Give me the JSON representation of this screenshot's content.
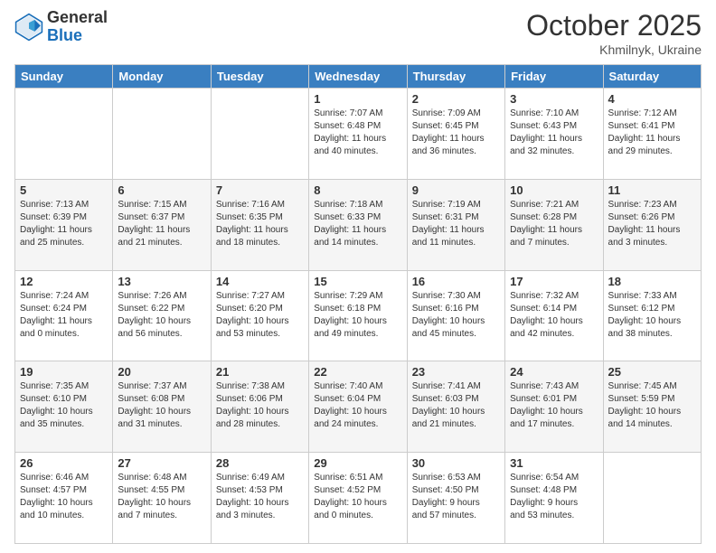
{
  "header": {
    "logo_general": "General",
    "logo_blue": "Blue",
    "month_title": "October 2025",
    "location": "Khmilnyk, Ukraine"
  },
  "days_of_week": [
    "Sunday",
    "Monday",
    "Tuesday",
    "Wednesday",
    "Thursday",
    "Friday",
    "Saturday"
  ],
  "weeks": [
    [
      {
        "day": "",
        "info": ""
      },
      {
        "day": "",
        "info": ""
      },
      {
        "day": "",
        "info": ""
      },
      {
        "day": "1",
        "info": "Sunrise: 7:07 AM\nSunset: 6:48 PM\nDaylight: 11 hours\nand 40 minutes."
      },
      {
        "day": "2",
        "info": "Sunrise: 7:09 AM\nSunset: 6:45 PM\nDaylight: 11 hours\nand 36 minutes."
      },
      {
        "day": "3",
        "info": "Sunrise: 7:10 AM\nSunset: 6:43 PM\nDaylight: 11 hours\nand 32 minutes."
      },
      {
        "day": "4",
        "info": "Sunrise: 7:12 AM\nSunset: 6:41 PM\nDaylight: 11 hours\nand 29 minutes."
      }
    ],
    [
      {
        "day": "5",
        "info": "Sunrise: 7:13 AM\nSunset: 6:39 PM\nDaylight: 11 hours\nand 25 minutes."
      },
      {
        "day": "6",
        "info": "Sunrise: 7:15 AM\nSunset: 6:37 PM\nDaylight: 11 hours\nand 21 minutes."
      },
      {
        "day": "7",
        "info": "Sunrise: 7:16 AM\nSunset: 6:35 PM\nDaylight: 11 hours\nand 18 minutes."
      },
      {
        "day": "8",
        "info": "Sunrise: 7:18 AM\nSunset: 6:33 PM\nDaylight: 11 hours\nand 14 minutes."
      },
      {
        "day": "9",
        "info": "Sunrise: 7:19 AM\nSunset: 6:31 PM\nDaylight: 11 hours\nand 11 minutes."
      },
      {
        "day": "10",
        "info": "Sunrise: 7:21 AM\nSunset: 6:28 PM\nDaylight: 11 hours\nand 7 minutes."
      },
      {
        "day": "11",
        "info": "Sunrise: 7:23 AM\nSunset: 6:26 PM\nDaylight: 11 hours\nand 3 minutes."
      }
    ],
    [
      {
        "day": "12",
        "info": "Sunrise: 7:24 AM\nSunset: 6:24 PM\nDaylight: 11 hours\nand 0 minutes."
      },
      {
        "day": "13",
        "info": "Sunrise: 7:26 AM\nSunset: 6:22 PM\nDaylight: 10 hours\nand 56 minutes."
      },
      {
        "day": "14",
        "info": "Sunrise: 7:27 AM\nSunset: 6:20 PM\nDaylight: 10 hours\nand 53 minutes."
      },
      {
        "day": "15",
        "info": "Sunrise: 7:29 AM\nSunset: 6:18 PM\nDaylight: 10 hours\nand 49 minutes."
      },
      {
        "day": "16",
        "info": "Sunrise: 7:30 AM\nSunset: 6:16 PM\nDaylight: 10 hours\nand 45 minutes."
      },
      {
        "day": "17",
        "info": "Sunrise: 7:32 AM\nSunset: 6:14 PM\nDaylight: 10 hours\nand 42 minutes."
      },
      {
        "day": "18",
        "info": "Sunrise: 7:33 AM\nSunset: 6:12 PM\nDaylight: 10 hours\nand 38 minutes."
      }
    ],
    [
      {
        "day": "19",
        "info": "Sunrise: 7:35 AM\nSunset: 6:10 PM\nDaylight: 10 hours\nand 35 minutes."
      },
      {
        "day": "20",
        "info": "Sunrise: 7:37 AM\nSunset: 6:08 PM\nDaylight: 10 hours\nand 31 minutes."
      },
      {
        "day": "21",
        "info": "Sunrise: 7:38 AM\nSunset: 6:06 PM\nDaylight: 10 hours\nand 28 minutes."
      },
      {
        "day": "22",
        "info": "Sunrise: 7:40 AM\nSunset: 6:04 PM\nDaylight: 10 hours\nand 24 minutes."
      },
      {
        "day": "23",
        "info": "Sunrise: 7:41 AM\nSunset: 6:03 PM\nDaylight: 10 hours\nand 21 minutes."
      },
      {
        "day": "24",
        "info": "Sunrise: 7:43 AM\nSunset: 6:01 PM\nDaylight: 10 hours\nand 17 minutes."
      },
      {
        "day": "25",
        "info": "Sunrise: 7:45 AM\nSunset: 5:59 PM\nDaylight: 10 hours\nand 14 minutes."
      }
    ],
    [
      {
        "day": "26",
        "info": "Sunrise: 6:46 AM\nSunset: 4:57 PM\nDaylight: 10 hours\nand 10 minutes."
      },
      {
        "day": "27",
        "info": "Sunrise: 6:48 AM\nSunset: 4:55 PM\nDaylight: 10 hours\nand 7 minutes."
      },
      {
        "day": "28",
        "info": "Sunrise: 6:49 AM\nSunset: 4:53 PM\nDaylight: 10 hours\nand 3 minutes."
      },
      {
        "day": "29",
        "info": "Sunrise: 6:51 AM\nSunset: 4:52 PM\nDaylight: 10 hours\nand 0 minutes."
      },
      {
        "day": "30",
        "info": "Sunrise: 6:53 AM\nSunset: 4:50 PM\nDaylight: 9 hours\nand 57 minutes."
      },
      {
        "day": "31",
        "info": "Sunrise: 6:54 AM\nSunset: 4:48 PM\nDaylight: 9 hours\nand 53 minutes."
      },
      {
        "day": "",
        "info": ""
      }
    ]
  ]
}
